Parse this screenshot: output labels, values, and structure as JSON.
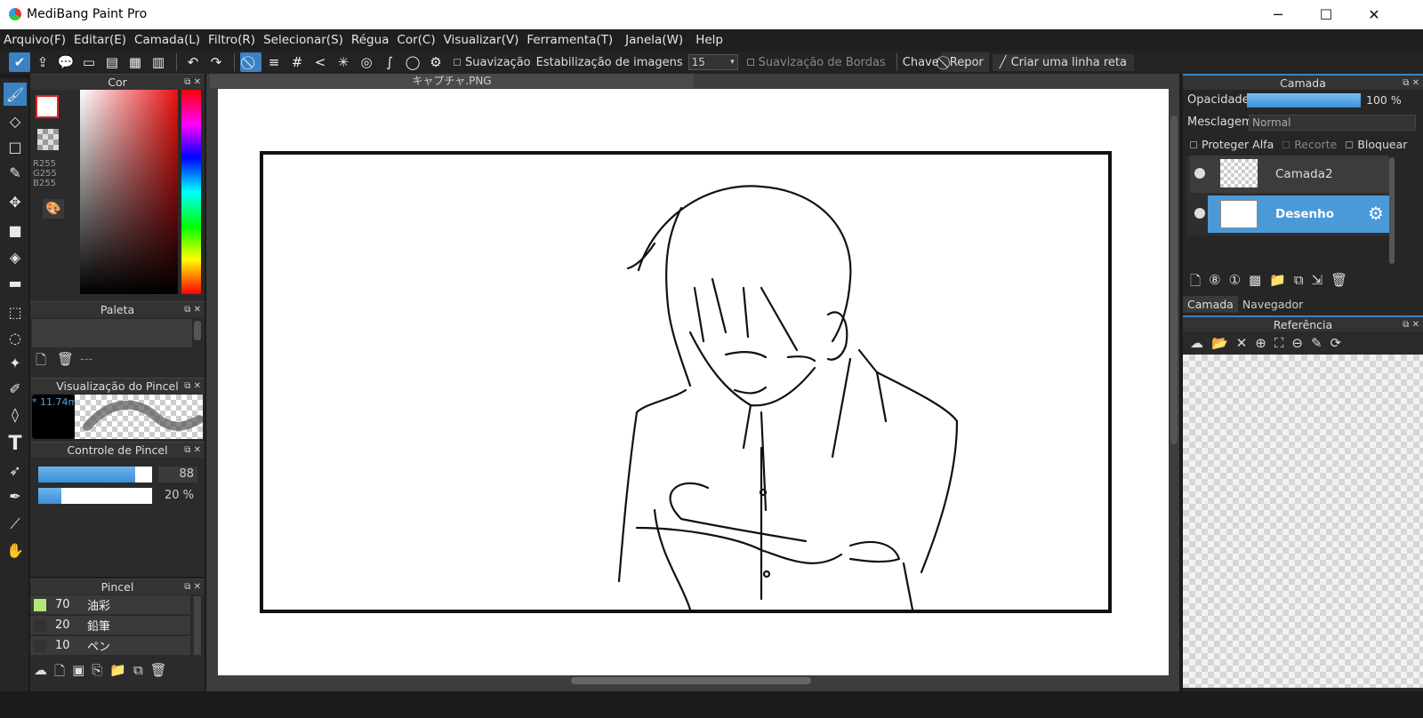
{
  "window": {
    "title": "MediBang Paint Pro"
  },
  "menu": [
    "Arquivo(F)",
    "Editar(E)",
    "Camada(L)",
    "Filtro(R)",
    "Selecionar(S)",
    "Régua",
    "Cor(C)",
    "Visualizar(V)",
    "Ferramenta(T)",
    "Janela(W)",
    "Help"
  ],
  "toolbar": {
    "smoothing_label": "Suavização",
    "stabilization_label": "Estabilização de imagens",
    "stabilization_value": "15",
    "edge_smoothing_label": "Suavização de Bordas",
    "key_label": "Chave",
    "reset_label": "Repor",
    "straight_line_label": "Criar uma linha reta"
  },
  "color_panel": {
    "title": "Cor",
    "r": "R255",
    "g": "G255",
    "b": "B255",
    "fg_color": "#ffffff",
    "bg_color": "#ffffff"
  },
  "palette_panel": {
    "title": "Paleta",
    "placeholder": "---"
  },
  "brush_preview_panel": {
    "title": "Visualização do Pincel",
    "size": "11.74m"
  },
  "brush_control_panel": {
    "title": "Controle de Pincel",
    "size_value": "88",
    "size_fraction": 0.85,
    "opacity_value": "20 %",
    "opacity_fraction": 0.2
  },
  "brush_panel": {
    "title": "Pincel",
    "brushes": [
      {
        "size": "70",
        "name": "油彩",
        "color": "#b4e67a"
      },
      {
        "size": "20",
        "name": "鉛筆",
        "color": "#333333"
      },
      {
        "size": "10",
        "name": "ペン",
        "color": "#333333"
      }
    ]
  },
  "canvas": {
    "tab_title": "キャプチャ.PNG"
  },
  "layer_panel": {
    "title": "Camada",
    "opacity_label": "Opacidade",
    "opacity_value": "100 %",
    "blend_label": "Mesclagem",
    "blend_value": "Normal",
    "protect_alpha": "Proteger Alfa",
    "clip": "Recorte",
    "lock": "Bloquear",
    "layers": [
      {
        "name": "Camada2",
        "selected": false
      },
      {
        "name": "Desenho",
        "selected": true
      }
    ],
    "tabs": [
      "Camada",
      "Navegador"
    ]
  },
  "reference_panel": {
    "title": "Referência"
  },
  "colors": {
    "accent": "#3b82c4",
    "selected_layer": "#4a9ad8"
  }
}
